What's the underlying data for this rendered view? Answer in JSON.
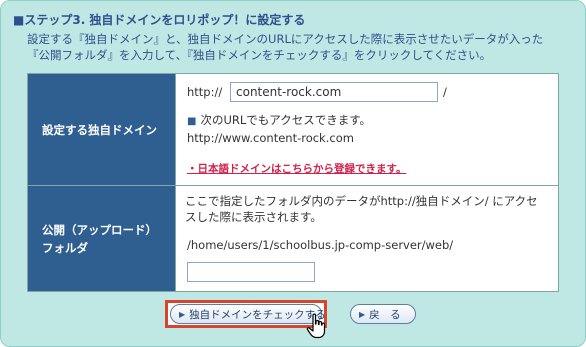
{
  "heading": "■ステップ3. 独自ドメインをロリポップ！に設定する",
  "intro": {
    "line1": "設定する『独自ドメイン』と、独自ドメインのURLにアクセスした際に表示させたいデータが入った",
    "line2": "『公開フォルダ』を入力して、『独自ドメインをチェックする』をクリックしてください。"
  },
  "domain_row": {
    "label": "設定する独自ドメイン",
    "prefix": "http://",
    "input_value": "content-rock.com",
    "suffix": "/",
    "access_note": "次のURLでもアクセスできます。",
    "square_glyph": "■",
    "alt_url": "http://www.content-rock.com",
    "jp_domain_link": "・日本語ドメインはこちらから登録できます。"
  },
  "folder_row": {
    "label_line1": "公開（アップロード）",
    "label_line2": "フォルダ",
    "desc_line1": "ここで指定したフォルダ内のデータがhttp://独自ドメイン/ にアクセ",
    "desc_line2": "スした際に表示されます。",
    "path": "/home/users/1/schoolbus.jp-comp-server/web/",
    "input_value": ""
  },
  "buttons": {
    "check_label": "独自ドメインをチェックする",
    "back_label": "戻　る"
  },
  "colors": {
    "panel_bg": "#bfe8e4",
    "label_bg": "#2f5f91",
    "heading_text": "#2f4f8f",
    "link_red": "#d0234b",
    "highlight_border": "#d9442a"
  },
  "icons": {
    "button_arrow": "triangle-right-icon",
    "cursor": "hand-pointer-cursor-icon"
  }
}
